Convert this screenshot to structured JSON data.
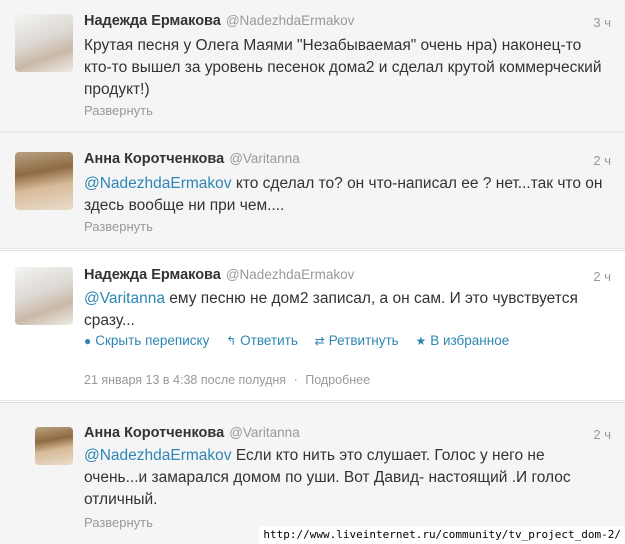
{
  "tweets": [
    {
      "name": "Надежда Ермакова",
      "handle": "@NadezhdaErmakov",
      "time": "3 ч",
      "text": "Крутая песня у Олега Маями \"Незабываемая\" очень нра) наконец-то кто-то вышел за уровень песенок дома2 и сделал крутой коммерческий продукт!)",
      "expand": "Развернуть"
    },
    {
      "name": "Анна Коротченкова",
      "handle": "@Varitanna",
      "time": "2 ч",
      "mention": "@NadezhdaErmakov",
      "text": " кто сделал то? он что-написал ее ? нет...так что он здесь вообще ни при чем....",
      "expand": "Развернуть"
    },
    {
      "name": "Надежда Ермакова",
      "handle": "@NadezhdaErmakov",
      "time": "2 ч",
      "mention": "@Varitanna",
      "text": " ему песню не дом2 записал, а он сам. И это чувствуется сразу...",
      "actions": {
        "hide": "Скрыть переписку",
        "reply": "Ответить",
        "retweet": "Ретвитнуть",
        "favorite": "В избранное"
      },
      "date": "21 января 13 в 4:38 после полудня",
      "sep": "·",
      "details": "Подробнее"
    },
    {
      "name": "Анна Коротченкова",
      "handle": "@Varitanna",
      "time": "2 ч",
      "mention": "@NadezhdaErmakov",
      "text": " Если кто нить это слушает. Голос у него не очень...и замарался домом по уши. Вот Давид- настоящий .И голос отличный.",
      "expand": "Развернуть"
    }
  ],
  "url": "http://www.liveinternet.ru/community/tv_project_dom-2/"
}
